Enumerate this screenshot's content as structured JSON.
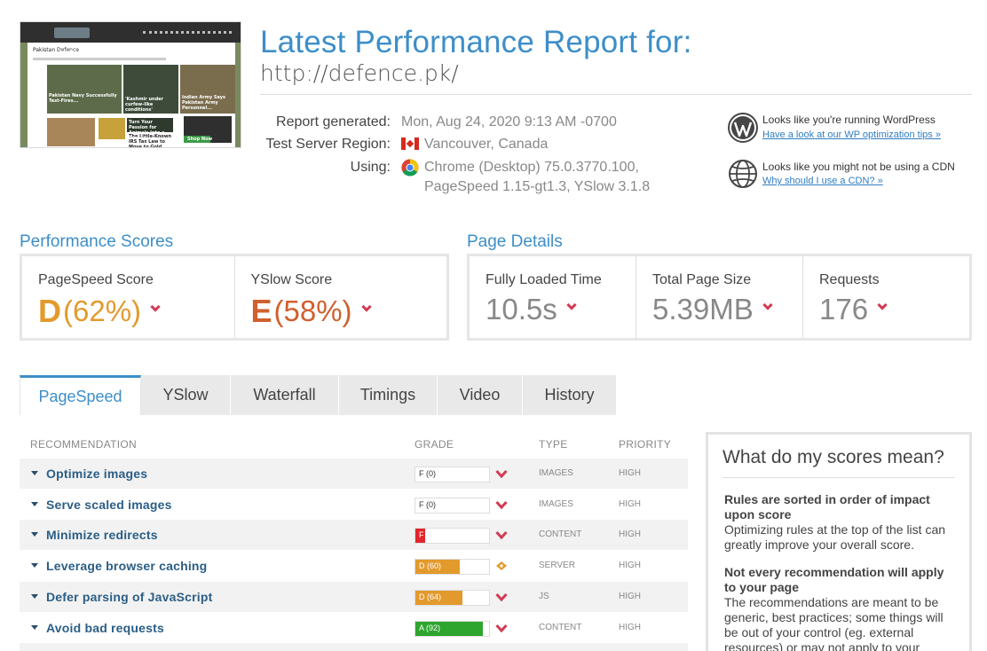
{
  "header": {
    "title": "Latest Performance Report for:",
    "url": "http://defence.pk/",
    "meta": [
      {
        "label": "Report generated:",
        "value": "Mon, Aug 24, 2020 9:13 AM -0700"
      },
      {
        "label": "Test Server Region:",
        "value": "Vancouver, Canada"
      },
      {
        "label": "Using:",
        "value": "Chrome (Desktop) 75.0.3770.100,",
        "value2": "PageSpeed 1.15-gt1.3, YSlow 3.1.8"
      }
    ],
    "hints": [
      {
        "text": "Looks like you're running WordPress",
        "link": "Have a look at our WP optimization tips »",
        "icon": "wordpress-icon"
      },
      {
        "text": "Looks like you might not be using a CDN",
        "link": "Why should I use a CDN? »",
        "icon": "globe-icon"
      }
    ]
  },
  "thumbnail": {
    "site_label": "DEFENCE",
    "section": "Pakistan Defence",
    "captions": [
      "Pakistan Navy Successfully Test-Fires...",
      "'Kashmir under curfew-like conditions'",
      "Indian Army Says Pakistan Army Personnel...",
      "Turn Your Passion for Animals Into a Career",
      "The Little-Known IRS Tax Law to Move to Gold"
    ],
    "button": "Shop Now"
  },
  "performance": {
    "section_title": "Performance Scores",
    "pagespeed": {
      "label": "PageSpeed Score",
      "grade": "D",
      "percent": "(62%)",
      "color": "#e39a2d"
    },
    "yslow": {
      "label": "YSlow Score",
      "grade": "E",
      "percent": "(58%)",
      "color": "#d0602e"
    }
  },
  "details": {
    "section_title": "Page Details",
    "fully_loaded": {
      "label": "Fully Loaded Time",
      "value": "10.5s"
    },
    "page_size": {
      "label": "Total Page Size",
      "value": "5.39MB"
    },
    "requests": {
      "label": "Requests",
      "value": "176"
    }
  },
  "tabs": [
    "PageSpeed",
    "YSlow",
    "Waterfall",
    "Timings",
    "Video",
    "History"
  ],
  "table": {
    "headers": {
      "recommendation": "RECOMMENDATION",
      "grade": "GRADE",
      "type": "TYPE",
      "priority": "PRIORITY"
    },
    "rows": [
      {
        "name": "Optimize images",
        "grade": "F (0)",
        "score": 0,
        "color": "#e0262c",
        "type": "IMAGES",
        "priority": "HIGH",
        "indicator": "down"
      },
      {
        "name": "Serve scaled images",
        "grade": "F (0)",
        "score": 0,
        "color": "#e0262c",
        "type": "IMAGES",
        "priority": "HIGH",
        "indicator": "down"
      },
      {
        "name": "Minimize redirects",
        "grade": "F (13)",
        "score": 13,
        "color": "#e0262c",
        "type": "CONTENT",
        "priority": "HIGH",
        "indicator": "down"
      },
      {
        "name": "Leverage browser caching",
        "grade": "D (60)",
        "score": 60,
        "color": "#e39a2d",
        "type": "SERVER",
        "priority": "HIGH",
        "indicator": "diamond"
      },
      {
        "name": "Defer parsing of JavaScript",
        "grade": "D (64)",
        "score": 64,
        "color": "#e39a2d",
        "type": "JS",
        "priority": "HIGH",
        "indicator": "down"
      },
      {
        "name": "Avoid bad requests",
        "grade": "A (92)",
        "score": 92,
        "color": "#2ea52e",
        "type": "CONTENT",
        "priority": "HIGH",
        "indicator": "down"
      }
    ]
  },
  "sidebox": {
    "title": "What do my scores mean?",
    "items": [
      {
        "q": "Rules are sorted in order of impact upon score",
        "a": "Optimizing rules at the top of the list can greatly improve your overall score."
      },
      {
        "q": "Not every recommendation will apply to your page",
        "a": "The recommendations are meant to be generic, best practices; some things will be out of your control (eg. external resources) or may not apply to your"
      }
    ]
  },
  "colors": {
    "accent": "#3d8ec8",
    "caret": "#d23b53",
    "link": "#2b5e86"
  }
}
